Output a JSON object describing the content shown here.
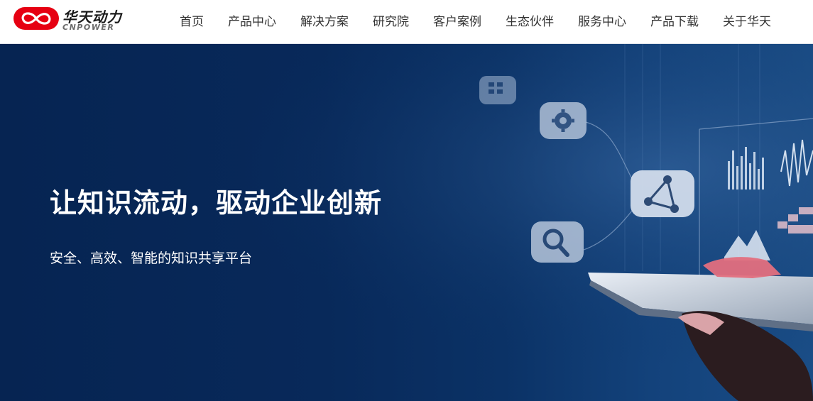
{
  "brand": {
    "name_cn": "华天动力",
    "name_en": "CNPOWER",
    "logo_color": "#e60012"
  },
  "nav": {
    "items": [
      {
        "label": "首页"
      },
      {
        "label": "产品中心"
      },
      {
        "label": "解决方案"
      },
      {
        "label": "研究院"
      },
      {
        "label": "客户案例"
      },
      {
        "label": "生态伙伴"
      },
      {
        "label": "服务中心"
      },
      {
        "label": "产品下载"
      },
      {
        "label": "关于华天"
      }
    ]
  },
  "hero": {
    "title": "让知识流动，驱动企业创新",
    "subtitle": "安全、高效、智能的知识共享平台",
    "background_color": "#082a5c",
    "icons": [
      "grid-icon",
      "gear-icon",
      "triangle-network-icon",
      "search-icon"
    ]
  }
}
